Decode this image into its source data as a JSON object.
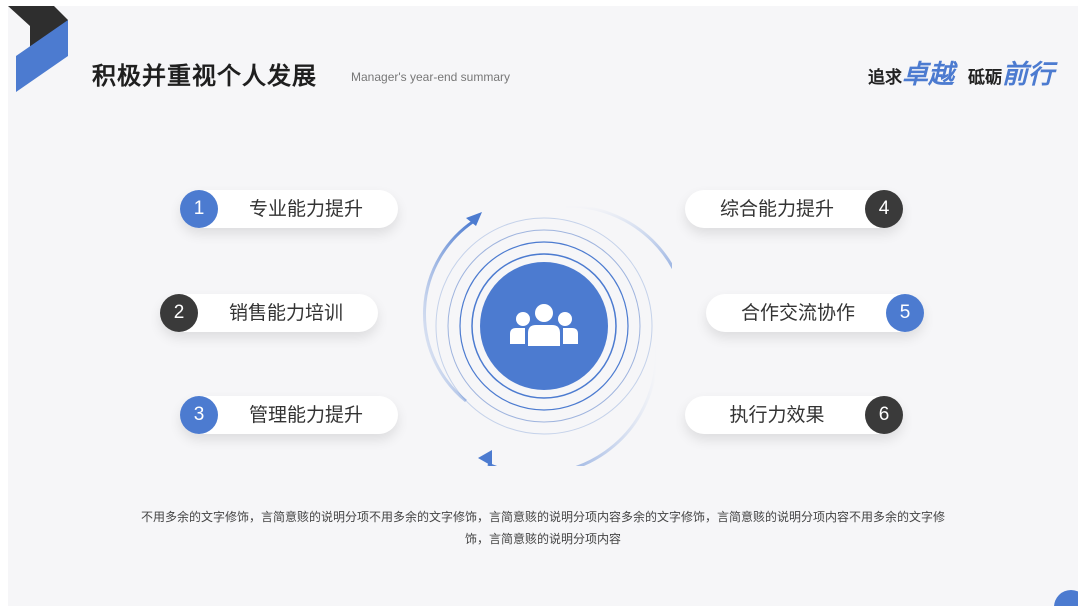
{
  "header": {
    "title": "积极并重视个人发展",
    "subtitle": "Manager's year-end summary",
    "slogan": [
      "追求",
      "卓越",
      "砥砺",
      "前行"
    ]
  },
  "items": [
    {
      "num": "1",
      "label": "专业能力提升",
      "side": "left",
      "color": "#4c7bd0"
    },
    {
      "num": "2",
      "label": "销售能力培训",
      "side": "left",
      "color": "#3a3a3a"
    },
    {
      "num": "3",
      "label": "管理能力提升",
      "side": "left",
      "color": "#4c7bd0"
    },
    {
      "num": "4",
      "label": "综合能力提升",
      "side": "right",
      "color": "#3a3a3a"
    },
    {
      "num": "5",
      "label": "合作交流协作",
      "side": "right",
      "color": "#4c7bd0"
    },
    {
      "num": "6",
      "label": "执行力效果",
      "side": "right",
      "color": "#3a3a3a"
    }
  ],
  "center_icon": "team-icon",
  "description": "不用多余的文字修饰，言简意赅的说明分项不用多余的文字修饰，言简意赅的说明分项内容多余的文字修饰，言简意赅的说明分项内容不用多余的文字修饰，言简意赅的说明分项内容",
  "colors": {
    "accent": "#4c7bd0",
    "dark": "#3a3a3a"
  }
}
